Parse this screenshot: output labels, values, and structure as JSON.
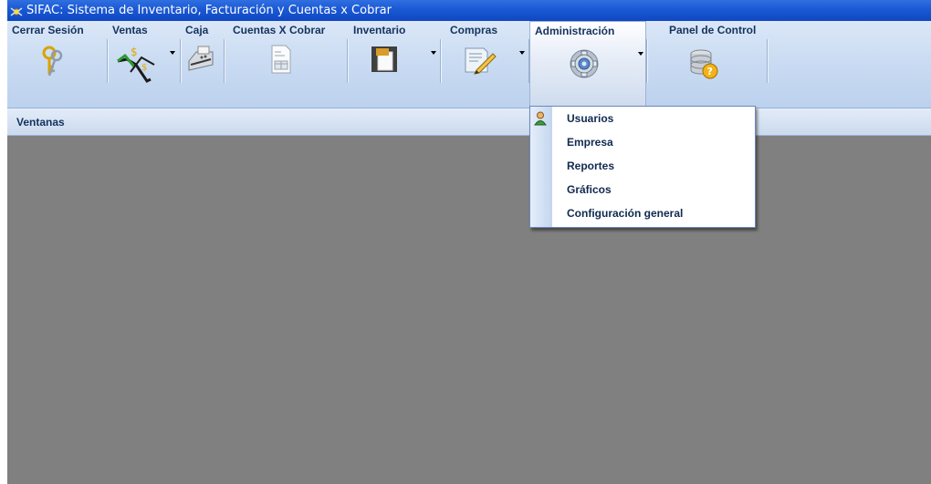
{
  "window": {
    "title": "SIFAC: Sistema de Inventario, Facturación y Cuentas x Cobrar"
  },
  "ribbon": {
    "buttons": [
      {
        "label": "Cerrar Sesión",
        "icon": "keys-icon"
      },
      {
        "label": "Ventas",
        "icon": "sales-icon"
      },
      {
        "label": "Caja",
        "icon": "cash-register-icon"
      },
      {
        "label": "Cuentas X Cobrar",
        "icon": "invoice-icon"
      },
      {
        "label": "Inventario",
        "icon": "clipboard-icon"
      },
      {
        "label": "Compras",
        "icon": "edit-document-icon"
      },
      {
        "label": "Administración",
        "icon": "gear-icon"
      },
      {
        "label": "Panel de Control",
        "icon": "database-help-icon"
      }
    ],
    "active": "Administración"
  },
  "window_bar": {
    "label": "Ventanas"
  },
  "admin_menu": {
    "items": [
      {
        "label": "Usuarios",
        "icon": "user-icon"
      },
      {
        "label": "Empresa"
      },
      {
        "label": "Reportes"
      },
      {
        "label": "Gráficos"
      },
      {
        "label": "Configuración general"
      }
    ]
  },
  "colors": {
    "titlebar": "#1a58d4",
    "ribbon": "#c9dbf2",
    "workspace": "#808080",
    "menu_text": "#10294f"
  }
}
